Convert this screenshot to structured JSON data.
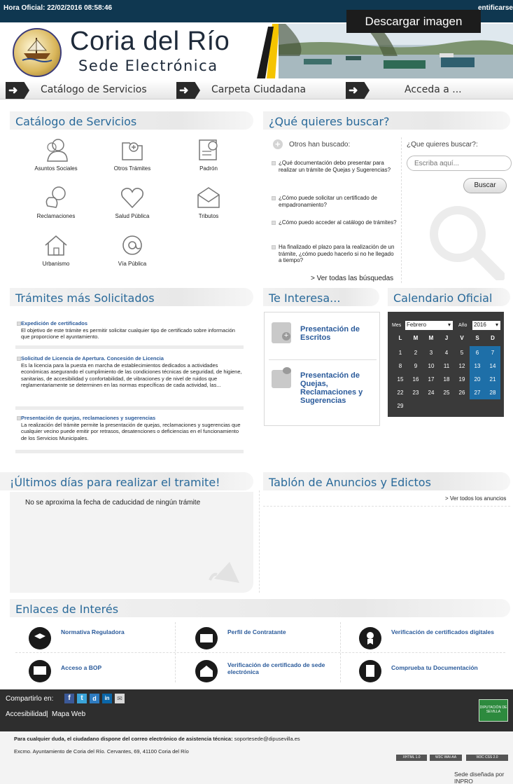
{
  "topbar": {
    "hora": "Hora Oficial: 22/02/2016 08:58:46",
    "cert": "entificarse"
  },
  "overlay": {
    "download_label": "Descargar imagen"
  },
  "header": {
    "title": "Coria del Río",
    "subtitle": "Sede Electrónica"
  },
  "nav": {
    "items": [
      {
        "label": "Catálogo de Servicios"
      },
      {
        "label": "Carpeta Ciudadana"
      },
      {
        "label": "Acceda a ..."
      }
    ]
  },
  "catalogo": {
    "heading": "Catálogo de Servicios",
    "services": [
      {
        "label": "Asuntos Sociales",
        "icon": "people-icon"
      },
      {
        "label": "Otros Trámites",
        "icon": "folder-plus-icon"
      },
      {
        "label": "Padrón",
        "icon": "certificate-icon"
      },
      {
        "label": "Reclamaciones",
        "icon": "chat-bubbles-icon"
      },
      {
        "label": "Salud Pública",
        "icon": "heart-icon"
      },
      {
        "label": "Tributos",
        "icon": "envelope-icon"
      },
      {
        "label": "Urbanismo",
        "icon": "house-icon"
      },
      {
        "label": "Vía Pública",
        "icon": "at-sign-icon"
      }
    ]
  },
  "busqueda": {
    "heading": "¿Qué quieres buscar?",
    "otros_label": "Otros han buscado:",
    "questions": [
      "¿Qué documentación debo presentar para realizar un trámite de Quejas y Sugerencias?",
      "¿Cómo puede solicitar un certificado de empadronamiento?",
      "¿Cómo puedo acceder al catálogo de trámites?",
      "Ha finalizado el plazo para la realización de un trámite, ¿cómo puedo hacerlo si no he llegado a tiempo?"
    ],
    "ver_todas": "> Ver todas las búsquedas",
    "form_label": "¿Que quieres buscar?:",
    "placeholder": "Escriba aquí...",
    "button": "Buscar"
  },
  "tramites": {
    "heading": "Trámites más Solicitados",
    "items": [
      {
        "title": "Expedición de certificados",
        "desc": "El objetivo de este trámite es permitir solicitar cualquier tipo de certificado sobre información que proporcione el ayuntamiento."
      },
      {
        "title": "Solicitud de Licencia de Apertura. Concesión de Licencia",
        "desc": "Es la licencia para la puesta en marcha de establecimientos dedicados a actividades económicas asegurando el cumplimiento de las condiciones técnicas de seguridad, de higiene, sanitarias, de accesibilidad y confortabilidad, de vibraciones y de nivel de ruidos que reglamentariamente se determinen en las normas específicas de cada actividad, las..."
      },
      {
        "title": "Presentación de quejas, reclamaciones y sugerencias",
        "desc": "La realización del trámite permite la presentación de quejas, reclamaciones y sugerencias que cualquier vecino puede emitir por retrasos, desatenciones o deficiencias en el funcionamiento de los Servicios Municipales."
      }
    ]
  },
  "interesa": {
    "heading": "Te Interesa...",
    "items": [
      {
        "label": "Presentación de Escritos"
      },
      {
        "label": "Presentación de Quejas, Reclamaciones y Sugerencias"
      }
    ]
  },
  "calendario": {
    "heading": "Calendario Oficial",
    "mes_label": "Mes",
    "mes_value": "Febrero",
    "anio_label": "Año",
    "anio_value": "2016",
    "weekdays": [
      "L",
      "M",
      "M",
      "J",
      "V",
      "S",
      "D"
    ],
    "weeks": [
      [
        "1",
        "2",
        "3",
        "4",
        "5",
        "6",
        "7"
      ],
      [
        "8",
        "9",
        "10",
        "11",
        "12",
        "13",
        "14"
      ],
      [
        "15",
        "16",
        "17",
        "18",
        "19",
        "20",
        "21"
      ],
      [
        "22",
        "23",
        "24",
        "25",
        "26",
        "27",
        "28"
      ],
      [
        "29",
        "",
        "",
        "",
        "",
        "",
        ""
      ]
    ]
  },
  "ultimos": {
    "heading": "¡Últimos días para realizar el tramite!",
    "message": "No se aproxima la fecha de caducidad de ningún trámite"
  },
  "tablon": {
    "heading": "Tablón de Anuncios y Edictos",
    "ver_todos": "> Ver todos los anuncios"
  },
  "enlaces": {
    "heading": "Enlaces de Interés",
    "items": [
      {
        "label": "Normativa Reguladora",
        "icon": "graduation-cap-icon"
      },
      {
        "label": "Perfil de Contratante",
        "icon": "id-card-icon"
      },
      {
        "label": "Verificación de certificados digitales",
        "icon": "award-icon"
      },
      {
        "label": "Acceso a BOP",
        "icon": "monitor-icon"
      },
      {
        "label": "Verificación de certificado de sede electrónica",
        "icon": "home-lock-icon"
      },
      {
        "label": "Comprueba tu Documentación",
        "icon": "document-icon"
      }
    ]
  },
  "footer": {
    "compartir": "Compartirlo en:",
    "accesibilidad": "Accesibilidad",
    "separator": "|",
    "mapa": "Mapa Web",
    "diputacion": "DIPUTACIÓN DE SEVILLA",
    "duda_text": "Para cualquier duda, el ciudadano dispone del correo electrónico de asistencia técnica:",
    "email": "soportesede@dipusevilla.es",
    "address": "Excmo. Ayuntamiento de Coria del Río. Cervantes, 69, 41100 Coria del Río",
    "badges": [
      "XHTML 1.0",
      "W3C WAI-AA",
      "W3C CSS 2.0"
    ],
    "disenada": "Sede diseñada por INPRO"
  },
  "colors": {
    "topbar": "#0f3750",
    "link": "#2a5a9a",
    "heading": "#2a6a9a",
    "calendar_bg": "#3a3a3a",
    "calendar_weekend": "#1e6fa8"
  }
}
